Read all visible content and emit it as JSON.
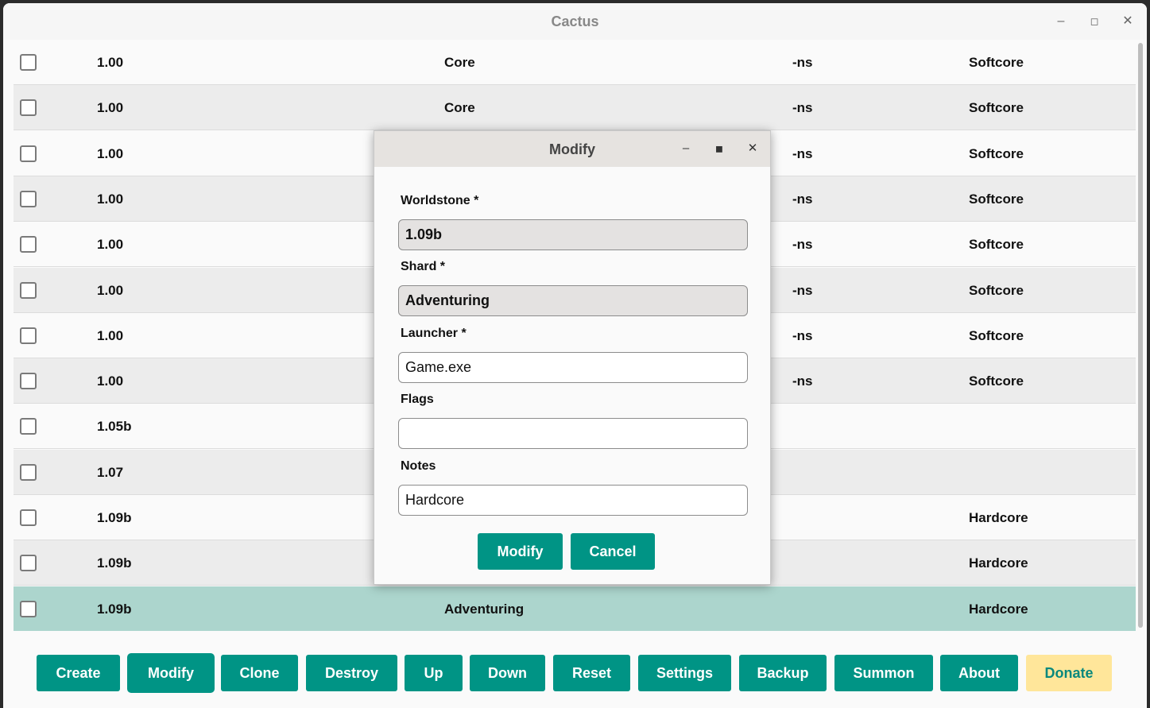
{
  "window": {
    "title": "Cactus"
  },
  "table": {
    "rows": [
      {
        "version": "1.00",
        "shard": "Core",
        "flags": "-ns",
        "notes": "Softcore"
      },
      {
        "version": "1.00",
        "shard": "Core",
        "flags": "-ns",
        "notes": "Softcore"
      },
      {
        "version": "1.00",
        "shard": "",
        "flags": "-ns",
        "notes": "Softcore"
      },
      {
        "version": "1.00",
        "shard": "",
        "flags": "-ns",
        "notes": "Softcore"
      },
      {
        "version": "1.00",
        "shard": "",
        "flags": "-ns",
        "notes": "Softcore"
      },
      {
        "version": "1.00",
        "shard": "",
        "flags": "-ns",
        "notes": "Softcore"
      },
      {
        "version": "1.00",
        "shard": "",
        "flags": "-ns",
        "notes": "Softcore"
      },
      {
        "version": "1.00",
        "shard": "",
        "flags": "-ns",
        "notes": "Softcore"
      },
      {
        "version": "1.05b",
        "shard": "",
        "flags": "",
        "notes": ""
      },
      {
        "version": "1.07",
        "shard": "",
        "flags": "",
        "notes": ""
      },
      {
        "version": "1.09b",
        "shard": "",
        "flags": "",
        "notes": "Hardcore"
      },
      {
        "version": "1.09b",
        "shard": "",
        "flags": "",
        "notes": "Hardcore"
      },
      {
        "version": "1.09b",
        "shard": "Adventuring",
        "flags": "",
        "notes": "Hardcore"
      }
    ]
  },
  "toolbar": {
    "create": "Create",
    "modify": "Modify",
    "clone": "Clone",
    "destroy": "Destroy",
    "up": "Up",
    "down": "Down",
    "reset": "Reset",
    "settings": "Settings",
    "backup": "Backup",
    "summon": "Summon",
    "about": "About",
    "donate": "Donate"
  },
  "dialog": {
    "title": "Modify",
    "worldstone_label": "Worldstone *",
    "worldstone_value": "1.09b",
    "shard_label": "Shard *",
    "shard_value": "Adventuring",
    "launcher_label": "Launcher *",
    "launcher_value": "Game.exe",
    "flags_label": "Flags",
    "flags_value": "",
    "notes_label": "Notes",
    "notes_value": "Hardcore",
    "modify_label": "Modify",
    "cancel_label": "Cancel"
  },
  "icons": {
    "minimize": "minimize-icon",
    "maximize": "maximize-icon",
    "close": "close-icon"
  },
  "colors": {
    "accent": "#009485",
    "selected_row": "#acd5cd",
    "donate_bg": "#ffe69a"
  }
}
